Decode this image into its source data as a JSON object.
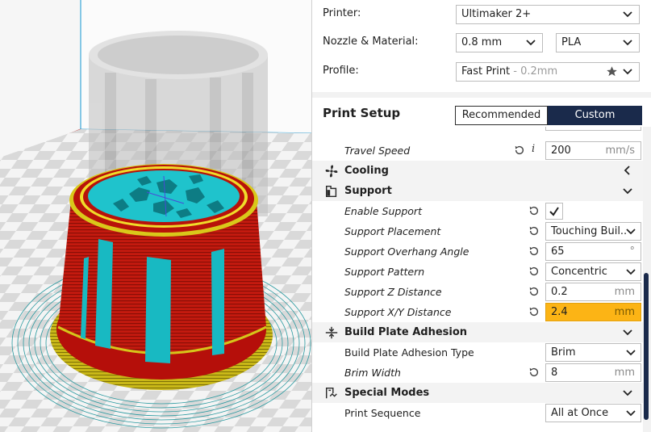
{
  "job": {
    "printer_label": "Printer:",
    "printer_value": "Ultimaker 2+",
    "nozzle_label": "Nozzle & Material:",
    "nozzle_value": "0.8 mm",
    "material_value": "PLA",
    "profile_label": "Profile:",
    "profile_value": "Fast Print",
    "profile_sub": " - 0.2mm"
  },
  "setup": {
    "title": "Print Setup",
    "recommended": "Recommended",
    "custom": "Custom"
  },
  "settings": {
    "travel_speed": {
      "label": "Travel Speed",
      "value": "200",
      "unit": "mm/s"
    },
    "cooling": {
      "label": "Cooling"
    },
    "support": {
      "label": "Support"
    },
    "enable_support": {
      "label": "Enable Support",
      "checked": true
    },
    "support_placement": {
      "label": "Support Placement",
      "value": "Touching Buil..."
    },
    "support_overhang": {
      "label": "Support Overhang Angle",
      "value": "65",
      "unit": "°"
    },
    "support_pattern": {
      "label": "Support Pattern",
      "value": "Concentric"
    },
    "support_z": {
      "label": "Support Z Distance",
      "value": "0.2",
      "unit": "mm"
    },
    "support_xy": {
      "label": "Support X/Y Distance",
      "value": "2.4",
      "unit": "mm"
    },
    "adhesion": {
      "label": "Build Plate Adhesion"
    },
    "adhesion_type": {
      "label": "Build Plate Adhesion Type",
      "value": "Brim"
    },
    "brim_width": {
      "label": "Brim Width",
      "value": "8",
      "unit": "mm"
    },
    "special_modes": {
      "label": "Special Modes"
    },
    "print_sequence": {
      "label": "Print Sequence",
      "value": "All at Once"
    }
  },
  "colors": {
    "accent": "#1a2a4b",
    "warning": "#fcb415",
    "model_red": "#c81e10",
    "model_yellow": "#d8c81a",
    "support_cyan": "#22c4cc"
  }
}
